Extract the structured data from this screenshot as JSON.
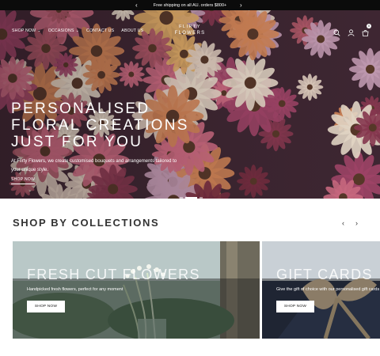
{
  "announcement": {
    "text": "Free shipping on all AU. orders $800+",
    "prev": "‹",
    "next": "›"
  },
  "header": {
    "nav": [
      {
        "label": "SHOP NOW",
        "has_dropdown": true
      },
      {
        "label": "OCCASIONS",
        "has_dropdown": true
      },
      {
        "label": "CONTACT US",
        "has_dropdown": false
      },
      {
        "label": "ABOUT US",
        "has_dropdown": false
      }
    ],
    "logo_line1": "FLIRTY",
    "logo_line2": "FLOWERS",
    "icons": [
      "search-icon",
      "account-icon",
      "cart-icon"
    ],
    "cart_count": "0",
    "chevron": "⌄"
  },
  "hero": {
    "title_lines": [
      "PERSONALISED",
      "FLORAL CREATIONS",
      "JUST FOR YOU"
    ],
    "description": "At Flirty Flowers, we create customised bouquets and arrangements tailored to your unique style.",
    "cta": "SHOP NOW",
    "slide_count": 3,
    "active_slide": 2
  },
  "collections": {
    "title": "SHOP BY COLLECTIONS",
    "prev": "‹",
    "next": "›",
    "cards": [
      {
        "title": "FRESH CUT FLOWERS",
        "description": "Handpicked fresh flowers, perfect for any moment",
        "button": "SHOP NOW"
      },
      {
        "title": "GIFT CARDS",
        "description": "Give the gift of choice with our personalised gift cards",
        "button": "SHOP NOW"
      }
    ]
  },
  "colors": {
    "announcement_bg": "#0b0b0b",
    "text_dark": "#333333",
    "white": "#ffffff"
  }
}
